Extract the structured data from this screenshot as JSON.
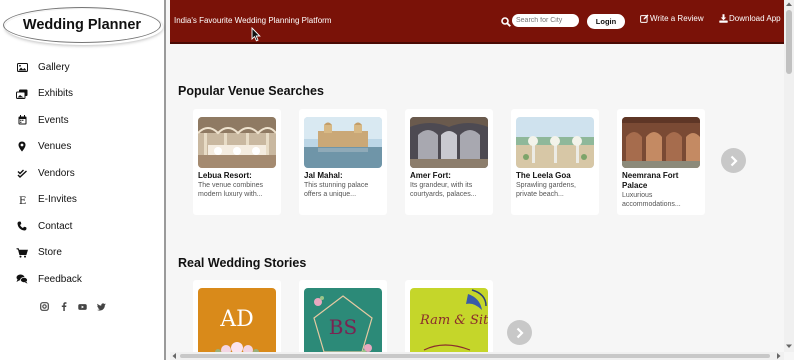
{
  "brand": {
    "logo_text": "Wedding Planner"
  },
  "sidebar": {
    "items": [
      {
        "label": "Gallery",
        "icon": "image-icon"
      },
      {
        "label": "Exhibits",
        "icon": "images-icon"
      },
      {
        "label": "Events",
        "icon": "calendar-icon"
      },
      {
        "label": "Venues",
        "icon": "map-pin-icon"
      },
      {
        "label": "Vendors",
        "icon": "double-check-icon"
      },
      {
        "label": "E-Invites",
        "icon": "letter-e-icon"
      },
      {
        "label": "Contact",
        "icon": "phone-icon"
      },
      {
        "label": "Store",
        "icon": "shopping-cart-icon"
      },
      {
        "label": "Feedback",
        "icon": "comments-icon"
      }
    ],
    "social": [
      "instagram-icon",
      "facebook-icon",
      "youtube-icon",
      "twitter-icon"
    ]
  },
  "header": {
    "tagline": "India's Favourite Wedding Planning Platform",
    "search_placeholder": "Search for City",
    "login_label": "Login",
    "review_label": "Write a Review",
    "download_label": "Download App",
    "bg_color": "#7a1208"
  },
  "venues": {
    "title": "Popular Venue Searches",
    "cards": [
      {
        "name": "Lebua Resort:",
        "desc": "The venue combines modern luxury with..."
      },
      {
        "name": "Jal Mahal:",
        "desc": "This stunning palace offers a unique..."
      },
      {
        "name": "Amer Fort:",
        "desc": "Its grandeur, with its courtyards, palaces..."
      },
      {
        "name": "The Leela Goa",
        "desc": "Sprawling gardens, private beach..."
      },
      {
        "name": "Neemrana Fort Palace",
        "desc": "Luxurious accommodations..."
      }
    ]
  },
  "stories": {
    "title": "Real Wedding Stories",
    "cards": [
      {
        "monogram": "AD",
        "bg": "#d98a1a"
      },
      {
        "monogram": "BS",
        "bg": "#2c8a78"
      },
      {
        "monogram": "Ram & Sita",
        "bg": "#c5d62a"
      }
    ]
  }
}
